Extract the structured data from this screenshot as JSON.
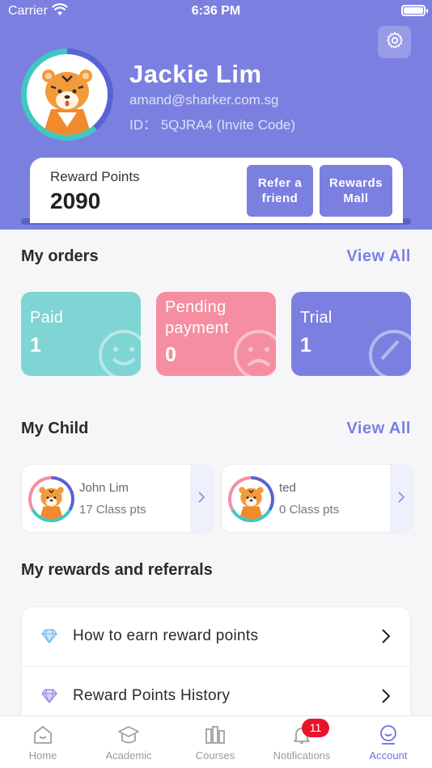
{
  "status_bar": {
    "carrier": "Carrier",
    "time": "6:36 PM"
  },
  "profile": {
    "name": "Jackie Lim",
    "email": "amand@sharker.com.sg",
    "id_line": "ID：  5QJRA4 (Invite Code)"
  },
  "points": {
    "label": "Reward Points",
    "value": "2090",
    "refer_label": "Refer a friend",
    "mall_label": "Rewards Mall"
  },
  "orders": {
    "title": "My orders",
    "view_all": "View All",
    "cards": [
      {
        "label": "Paid",
        "count": "1"
      },
      {
        "label": "Pending payment",
        "count": "0"
      },
      {
        "label": "Trial",
        "count": "1"
      }
    ]
  },
  "children": {
    "title": "My Child",
    "view_all": "View All",
    "items": [
      {
        "name": "John Lim",
        "points": "17 Class pts"
      },
      {
        "name": "ted",
        "points": "0 Class pts"
      }
    ]
  },
  "rewards": {
    "title": "My rewards and referrals",
    "items": [
      {
        "label": "How to earn reward points"
      },
      {
        "label": "Reward Points History"
      }
    ]
  },
  "tabbar": {
    "tabs": [
      {
        "label": "Home",
        "icon": "home-icon"
      },
      {
        "label": "Academic",
        "icon": "academic-icon"
      },
      {
        "label": "Courses",
        "icon": "courses-icon"
      },
      {
        "label": "Notifications",
        "icon": "bell-icon"
      },
      {
        "label": "Account",
        "icon": "account-icon"
      }
    ],
    "notification_badge": "11",
    "active": "Account"
  },
  "colors": {
    "primary": "#7b80e0",
    "paid": "#7fd5d3",
    "pending": "#f58ea0",
    "badge": "#e8152a"
  }
}
